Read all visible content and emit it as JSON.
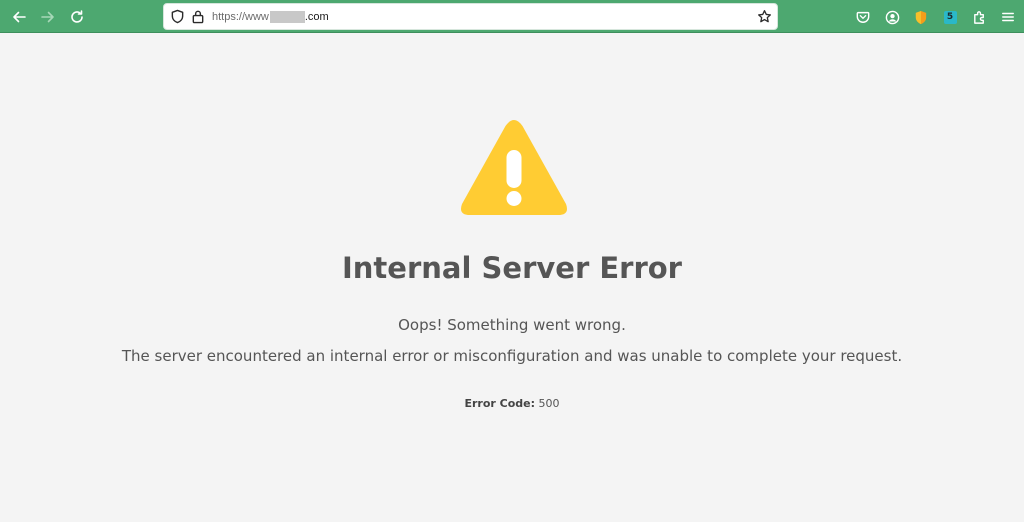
{
  "browser": {
    "url": {
      "protocol": "https://",
      "host_prefix": "www",
      "host_suffix": ".com"
    },
    "icons": [
      "back-icon",
      "forward-icon",
      "reload-icon",
      "shield-icon",
      "lock-icon",
      "bookmark-star-icon",
      "pocket-icon",
      "account-icon",
      "extension-shield-icon",
      "extension-badge-icon",
      "extensions-icon",
      "menu-icon"
    ],
    "extension_badge_text": "5",
    "toolbar_color": "#4da870"
  },
  "error_page": {
    "title": "Internal Server Error",
    "message": "Oops! Something went wrong.",
    "detail": "The server encountered an internal error or misconfiguration and was unable to complete your request.",
    "code_label": "Error Code:",
    "code_value": "500",
    "icon": "warning-icon",
    "icon_color": "#ffcc33",
    "text_color": "#555555"
  }
}
